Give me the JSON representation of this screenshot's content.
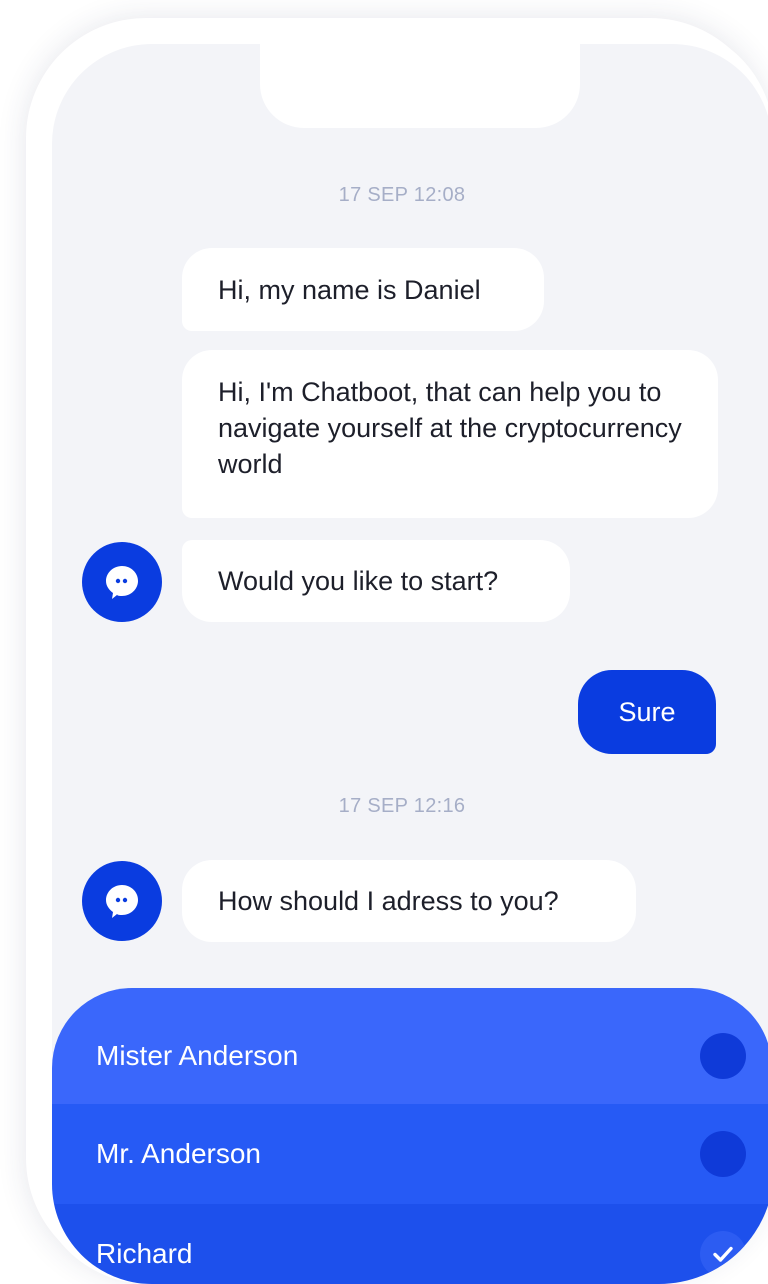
{
  "chat": {
    "timestamp_1": "17 SEP 12:08",
    "timestamp_2": "17 SEP 12:16",
    "messages": [
      {
        "from": "bot",
        "text": "Hi, my name is Daniel"
      },
      {
        "from": "bot",
        "text": "Hi, I'm Chatboot, that can help you to navigate yourself at the cryptocurrency world"
      },
      {
        "from": "bot",
        "text": "Would you like to start?"
      },
      {
        "from": "user",
        "text": "Sure"
      },
      {
        "from": "bot",
        "text": "How should I adress to you?"
      }
    ]
  },
  "options": [
    {
      "label": "Mister Anderson",
      "selected": false
    },
    {
      "label": "Mr. Anderson",
      "selected": false
    },
    {
      "label": "Richard",
      "selected": true
    }
  ],
  "icons": {
    "bot_avatar": "chat-bubble-icon",
    "selected": "check-icon"
  },
  "colors": {
    "accent": "#0a3ce0",
    "screen_bg": "#f3f4f8",
    "timestamp": "#a6aec7"
  }
}
